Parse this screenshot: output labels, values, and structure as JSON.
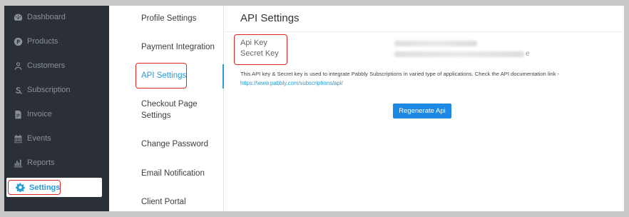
{
  "sidebar": {
    "items": [
      {
        "label": "Dashboard",
        "icon": "dashboard-icon"
      },
      {
        "label": "Products",
        "icon": "products-icon"
      },
      {
        "label": "Customers",
        "icon": "customers-icon"
      },
      {
        "label": "Subscription",
        "icon": "subscription-icon"
      },
      {
        "label": "Invoice",
        "icon": "invoice-icon"
      },
      {
        "label": "Events",
        "icon": "events-icon"
      },
      {
        "label": "Reports",
        "icon": "reports-icon"
      },
      {
        "label": "Settings",
        "icon": "gear-icon",
        "active": true
      }
    ]
  },
  "settings_menu": {
    "items": [
      {
        "label": "Profile Settings"
      },
      {
        "label": "Payment Integration"
      },
      {
        "label": "API Settings",
        "active": true
      },
      {
        "label": "Checkout Page Settings"
      },
      {
        "label": "Change Password"
      },
      {
        "label": "Email Notification"
      },
      {
        "label": "Client Portal"
      }
    ]
  },
  "api": {
    "title": "API Settings",
    "api_key_label": "Api Key",
    "secret_key_label": "Secret Key",
    "description": "This API key & Secret key is used to integrate Pabbly Subscriptions in varied type of applications. Check the API documentation link -",
    "doc_link": "https://www.pabbly.com/subscriptions/api/",
    "regenerate_label": "Regenerate Api",
    "secret_tail": "e"
  },
  "colors": {
    "accent": "#2a9ad6",
    "button": "#1e88e5",
    "sidebar_bg": "#2b3036",
    "highlight": "#e02424"
  }
}
